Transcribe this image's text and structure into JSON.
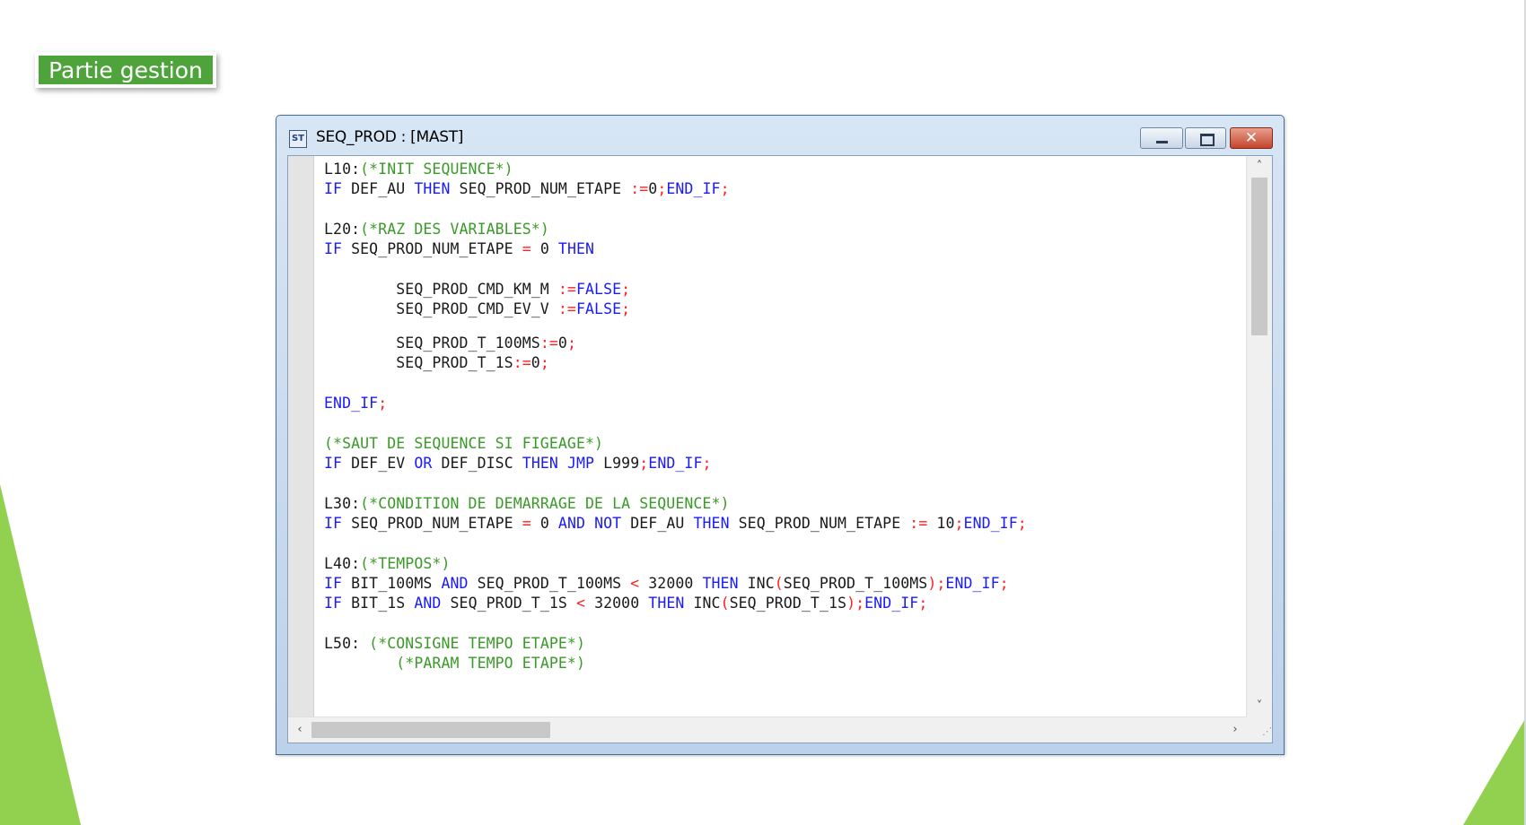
{
  "slide": {
    "badge_label": "Partie gestion"
  },
  "window": {
    "title": "SEQ_PROD : [MAST]",
    "icon_label": "ST",
    "icons": {
      "app": "st-program-icon",
      "minimize": "minimize-icon",
      "maximize": "maximize-icon",
      "close": "close-icon"
    }
  },
  "colors": {
    "keyword": "#1a1aff",
    "comment": "#3a9a28",
    "operator": "#ff2020",
    "identifier": "#1a1a1a",
    "badge": "#4ea33a",
    "decoration": "#92d050"
  },
  "code": {
    "lines": [
      {
        "segments": [
          {
            "t": "L10:",
            "c": "s0"
          },
          {
            "t": "(*INIT SEQUENCE*)",
            "c": "s2"
          }
        ]
      },
      {
        "segments": [
          {
            "t": "IF",
            "c": "s1"
          },
          {
            "t": " DEF_AU ",
            "c": "s0"
          },
          {
            "t": "THEN",
            "c": "s1"
          },
          {
            "t": " SEQ_PROD_NUM_ETAPE ",
            "c": "s0"
          },
          {
            "t": ":=",
            "c": "s3"
          },
          {
            "t": "0",
            "c": "s0"
          },
          {
            "t": ";",
            "c": "s3"
          },
          {
            "t": "END_IF",
            "c": "s1"
          },
          {
            "t": ";",
            "c": "s3"
          }
        ]
      },
      {
        "segments": []
      },
      {
        "segments": [
          {
            "t": "L20:",
            "c": "s0"
          },
          {
            "t": "(*RAZ DES VARIABLES*)",
            "c": "s2"
          }
        ]
      },
      {
        "segments": [
          {
            "t": "IF",
            "c": "s1"
          },
          {
            "t": " SEQ_PROD_NUM_ETAPE ",
            "c": "s0"
          },
          {
            "t": "=",
            "c": "s3"
          },
          {
            "t": " 0 ",
            "c": "s0"
          },
          {
            "t": "THEN",
            "c": "s1"
          }
        ]
      },
      {
        "segments": []
      },
      {
        "segments": [
          {
            "t": "        SEQ_PROD_CMD_KM_M ",
            "c": "s0"
          },
          {
            "t": ":=",
            "c": "s3"
          },
          {
            "t": "FALSE",
            "c": "s1"
          },
          {
            "t": ";",
            "c": "s3"
          }
        ]
      },
      {
        "segments": [
          {
            "t": "        SEQ_PROD_CMD_EV_V ",
            "c": "s0"
          },
          {
            "t": ":=",
            "c": "s3"
          },
          {
            "t": "FALSE",
            "c": "s1"
          },
          {
            "t": ";",
            "c": "s3"
          }
        ]
      },
      {
        "segments": []
      },
      {
        "segments": [
          {
            "t": "        SEQ_PROD_T_100MS",
            "c": "s0"
          },
          {
            "t": ":=",
            "c": "s3"
          },
          {
            "t": "0",
            "c": "s0"
          },
          {
            "t": ";",
            "c": "s3"
          }
        ]
      },
      {
        "segments": [
          {
            "t": "        SEQ_PROD_T_1S",
            "c": "s0"
          },
          {
            "t": ":=",
            "c": "s3"
          },
          {
            "t": "0",
            "c": "s0"
          },
          {
            "t": ";",
            "c": "s3"
          }
        ]
      },
      {
        "segments": []
      },
      {
        "segments": [
          {
            "t": "END_IF",
            "c": "s1"
          },
          {
            "t": ";",
            "c": "s3"
          }
        ]
      },
      {
        "segments": []
      },
      {
        "segments": [
          {
            "t": "(*SAUT DE SEQUENCE SI FIGEAGE*)",
            "c": "s2"
          }
        ]
      },
      {
        "segments": [
          {
            "t": "IF",
            "c": "s1"
          },
          {
            "t": " DEF_EV ",
            "c": "s0"
          },
          {
            "t": "OR",
            "c": "s1"
          },
          {
            "t": " DEF_DISC ",
            "c": "s0"
          },
          {
            "t": "THEN",
            "c": "s1"
          },
          {
            "t": " ",
            "c": "s0"
          },
          {
            "t": "JMP",
            "c": "s1"
          },
          {
            "t": " L999",
            "c": "s0"
          },
          {
            "t": ";",
            "c": "s3"
          },
          {
            "t": "END_IF",
            "c": "s1"
          },
          {
            "t": ";",
            "c": "s3"
          }
        ]
      },
      {
        "segments": []
      },
      {
        "segments": [
          {
            "t": "L30:",
            "c": "s0"
          },
          {
            "t": "(*CONDITION DE DEMARRAGE DE LA SEQUENCE*)",
            "c": "s2"
          }
        ]
      },
      {
        "segments": [
          {
            "t": "IF",
            "c": "s1"
          },
          {
            "t": " SEQ_PROD_NUM_ETAPE ",
            "c": "s0"
          },
          {
            "t": "=",
            "c": "s3"
          },
          {
            "t": " 0 ",
            "c": "s0"
          },
          {
            "t": "AND",
            "c": "s1"
          },
          {
            "t": " ",
            "c": "s0"
          },
          {
            "t": "NOT",
            "c": "s1"
          },
          {
            "t": " DEF_AU ",
            "c": "s0"
          },
          {
            "t": "THEN",
            "c": "s1"
          },
          {
            "t": " SEQ_PROD_NUM_ETAPE ",
            "c": "s0"
          },
          {
            "t": ":=",
            "c": "s3"
          },
          {
            "t": " 10",
            "c": "s0"
          },
          {
            "t": ";",
            "c": "s3"
          },
          {
            "t": "END_IF",
            "c": "s1"
          },
          {
            "t": ";",
            "c": "s3"
          }
        ]
      },
      {
        "segments": []
      },
      {
        "segments": [
          {
            "t": "L40:",
            "c": "s0"
          },
          {
            "t": "(*TEMPOS*)",
            "c": "s2"
          }
        ]
      },
      {
        "segments": [
          {
            "t": "IF",
            "c": "s1"
          },
          {
            "t": " BIT_100MS ",
            "c": "s0"
          },
          {
            "t": "AND",
            "c": "s1"
          },
          {
            "t": " SEQ_PROD_T_100MS ",
            "c": "s0"
          },
          {
            "t": "<",
            "c": "s3"
          },
          {
            "t": " 32000 ",
            "c": "s0"
          },
          {
            "t": "THEN",
            "c": "s1"
          },
          {
            "t": " INC",
            "c": "s0"
          },
          {
            "t": "(",
            "c": "s3"
          },
          {
            "t": "SEQ_PROD_T_100MS",
            "c": "s0"
          },
          {
            "t": ");",
            "c": "s3"
          },
          {
            "t": "END_IF",
            "c": "s1"
          },
          {
            "t": ";",
            "c": "s3"
          }
        ]
      },
      {
        "segments": [
          {
            "t": "IF",
            "c": "s1"
          },
          {
            "t": " BIT_1S ",
            "c": "s0"
          },
          {
            "t": "AND",
            "c": "s1"
          },
          {
            "t": " SEQ_PROD_T_1S ",
            "c": "s0"
          },
          {
            "t": "<",
            "c": "s3"
          },
          {
            "t": " 32000 ",
            "c": "s0"
          },
          {
            "t": "THEN",
            "c": "s1"
          },
          {
            "t": " INC",
            "c": "s0"
          },
          {
            "t": "(",
            "c": "s3"
          },
          {
            "t": "SEQ_PROD_T_1S",
            "c": "s0"
          },
          {
            "t": ");",
            "c": "s3"
          },
          {
            "t": "END_IF",
            "c": "s1"
          },
          {
            "t": ";",
            "c": "s3"
          }
        ]
      },
      {
        "segments": []
      },
      {
        "segments": [
          {
            "t": "L50: ",
            "c": "s0"
          },
          {
            "t": "(*CONSIGNE TEMPO ETAPE*)",
            "c": "s2"
          }
        ]
      },
      {
        "segments": [
          {
            "t": "        ",
            "c": "s0"
          },
          {
            "t": "(*PARAM TEMPO ETAPE*)",
            "c": "s2"
          }
        ]
      }
    ]
  },
  "scrollbars": {
    "up_arrow": "˄",
    "down_arrow": "˅",
    "left_arrow": "‹",
    "right_arrow": "›"
  }
}
